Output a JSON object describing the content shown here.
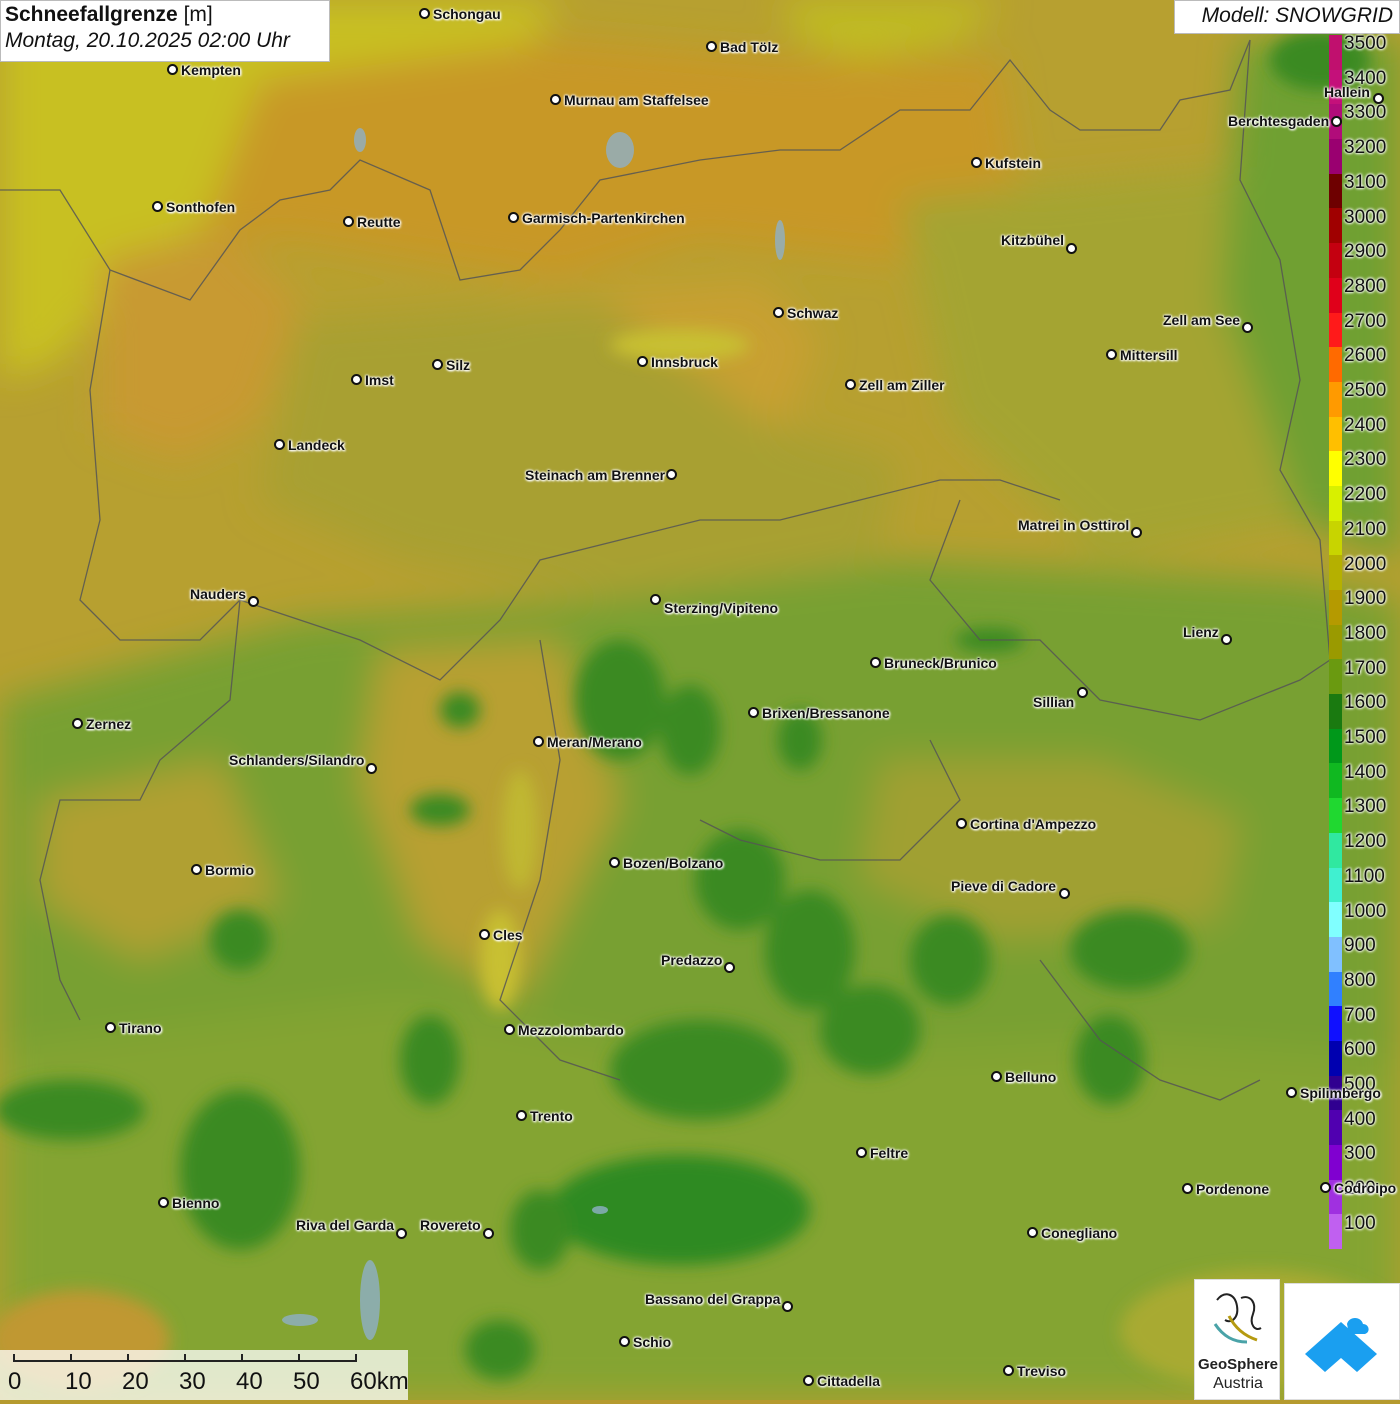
{
  "header": {
    "parameter": "Schneefallgrenze",
    "unit": "[m]",
    "datetime": "Montag, 20.10.2025 02:00 Uhr",
    "model": "Modell: SNOWGRID"
  },
  "legend": {
    "labels": [
      "3500",
      "3400",
      "3300",
      "3200",
      "3100",
      "3000",
      "2900",
      "2800",
      "2700",
      "2600",
      "2500",
      "2400",
      "2300",
      "2200",
      "2100",
      "2000",
      "1900",
      "1800",
      "1700",
      "1600",
      "1500",
      "1400",
      "1300",
      "1200",
      "1100",
      "1000",
      "900",
      "800",
      "700",
      "600",
      "500",
      "400",
      "300",
      "200",
      "100"
    ],
    "colors": [
      "#c0106e",
      "#c4107a",
      "#b10c7a",
      "#9a0070",
      "#6e0000",
      "#a00000",
      "#c40010",
      "#e0001a",
      "#ff1a1a",
      "#ff6a00",
      "#ff9a00",
      "#ffbf00",
      "#ffff00",
      "#d8f000",
      "#c8d400",
      "#b5b000",
      "#b59a00",
      "#9a9a00",
      "#6a9a10",
      "#1a7a10",
      "#00981a",
      "#10b820",
      "#20d830",
      "#30e8a0",
      "#40f0d0",
      "#80ffff",
      "#80c0ff",
      "#3080ff",
      "#1010ff",
      "#0000b0",
      "#300090",
      "#5000b0",
      "#8000d0",
      "#a030e0",
      "#c060f0"
    ]
  },
  "cities": [
    {
      "name": "Schongau"
    },
    {
      "name": "Kempten"
    },
    {
      "name": "Bad Tölz"
    },
    {
      "name": "Murnau am Staffelsee"
    },
    {
      "name": "Hallein"
    },
    {
      "name": "Berchtesgaden"
    },
    {
      "name": "Sonthofen"
    },
    {
      "name": "Reutte"
    },
    {
      "name": "Garmisch-Partenkirchen"
    },
    {
      "name": "Kufstein"
    },
    {
      "name": "Kitzbühel"
    },
    {
      "name": "Schwaz"
    },
    {
      "name": "Zell am See"
    },
    {
      "name": "Innsbruck"
    },
    {
      "name": "Silz"
    },
    {
      "name": "Imst"
    },
    {
      "name": "Mittersill"
    },
    {
      "name": "Zell am Ziller"
    },
    {
      "name": "Landeck"
    },
    {
      "name": "Steinach am Brenner"
    },
    {
      "name": "Matrei in Osttirol"
    },
    {
      "name": "Nauders"
    },
    {
      "name": "Sterzing/Vipiteno"
    },
    {
      "name": "Lienz"
    },
    {
      "name": "Bruneck/Brunico"
    },
    {
      "name": "Sillian"
    },
    {
      "name": "Zernez"
    },
    {
      "name": "Brixen/Bressanone"
    },
    {
      "name": "Meran/Merano"
    },
    {
      "name": "Schlanders/Silandro"
    },
    {
      "name": "Cortina d'Ampezzo"
    },
    {
      "name": "Bozen/Bolzano"
    },
    {
      "name": "Bormio"
    },
    {
      "name": "Pieve di Cadore"
    },
    {
      "name": "Cles"
    },
    {
      "name": "Predazzo"
    },
    {
      "name": "Tirano"
    },
    {
      "name": "Mezzolombardo"
    },
    {
      "name": "Belluno"
    },
    {
      "name": "Spilimbergo"
    },
    {
      "name": "Trento"
    },
    {
      "name": "Feltre"
    },
    {
      "name": "Pordenone"
    },
    {
      "name": "Codroipo"
    },
    {
      "name": "Bienno"
    },
    {
      "name": "Riva del Garda"
    },
    {
      "name": "Rovereto"
    },
    {
      "name": "Conegliano"
    },
    {
      "name": "Bassano del Grappa"
    },
    {
      "name": "Schio"
    },
    {
      "name": "Treviso"
    },
    {
      "name": "Cittadella"
    }
  ],
  "scale": {
    "ticks": [
      "0",
      "10",
      "20",
      "30",
      "40",
      "50",
      "60km"
    ]
  },
  "logo": {
    "name1": "GeoSphere",
    "name2": "Austria"
  }
}
